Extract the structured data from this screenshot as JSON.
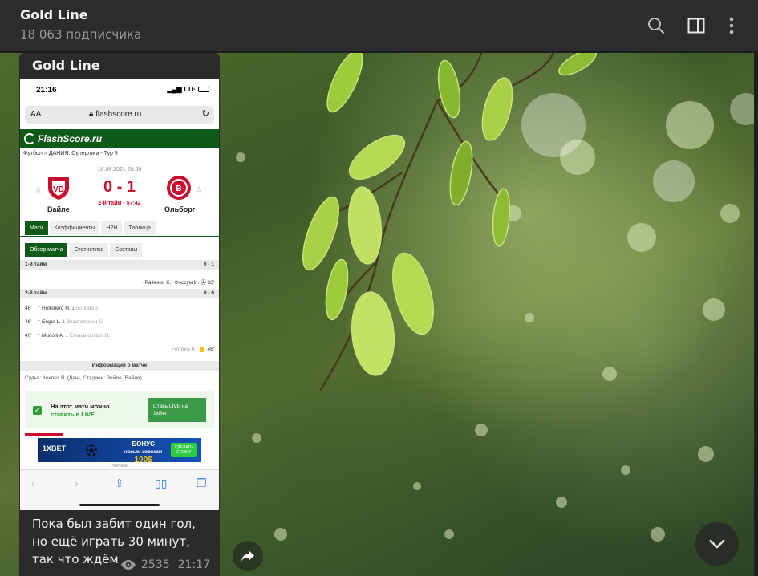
{
  "header": {
    "channel_title": "Gold Line",
    "subscribers": "18 063 подписчика",
    "icons": [
      "search-icon",
      "sidebar-toggle-icon",
      "more-vertical-icon"
    ]
  },
  "message": {
    "author": "Gold Line",
    "caption": "Пока был забит один гол, но ещё играть 30 минут, так что ждём",
    "views": "2535",
    "time": "21:17"
  },
  "screenshot": {
    "status_time": "21:16",
    "status_network": "LTE",
    "url_aa": "AA",
    "url": "flashscore.ru",
    "site_name": "FlashScore.ru",
    "breadcrumb": "Футбол > ДАНИЯ: Суперлига - Тур 5",
    "match_date": "16.08.2021 20:00",
    "score": "0 - 1",
    "match_status": "2-й тайм - 57:42",
    "home_team": "Вайле",
    "away_team": "Ольборг",
    "tabs": [
      "Матч",
      "Коэффициенты",
      "H2H",
      "Таблица"
    ],
    "subtabs": [
      "Обзор матча",
      "Статистика",
      "Составы"
    ],
    "first_half": {
      "label": "1-й тайм",
      "score": "0 - 1",
      "event": "(Palleson K.) Фоссум И.",
      "event_min": "33'"
    },
    "second_half": {
      "label": "2-й тайм",
      "score": "0 - 0"
    },
    "subs": [
      {
        "min": "46'",
        "in": "Hollsberg H.",
        "out": "Schoop J."
      },
      {
        "min": "46'",
        "in": "Engel L.",
        "out": "Эззатоллахи С."
      },
      {
        "min": "46'",
        "in": "Mucolli A.",
        "out": "Emmanouilidis D."
      }
    ],
    "card": {
      "player": "Ferreira P.",
      "min": "48'"
    },
    "info_title": "Информация о матче",
    "venue": "Судья: Кехлет Я. (Дан), Стадион: Вейле (Вайле)",
    "live_text_1": "На этот матч можно",
    "live_text_2": "ставить в LIVE",
    "live_btn": "Ставь LIVE на 1xBet",
    "banner_brand": "1XBET",
    "banner_bonus_1": "БОНУС",
    "banner_bonus_2": "новым игрокам",
    "banner_bonus_3": "100$",
    "banner_btn": "СДЕЛАТЬ СТАВКУ",
    "ad_label": "Реклама"
  },
  "colors": {
    "topbar_bg": "#2c2c2c",
    "bubble_bg": "#2b2b2b",
    "flashscore_green": "#0e5a17",
    "score_red": "#c8102e"
  }
}
